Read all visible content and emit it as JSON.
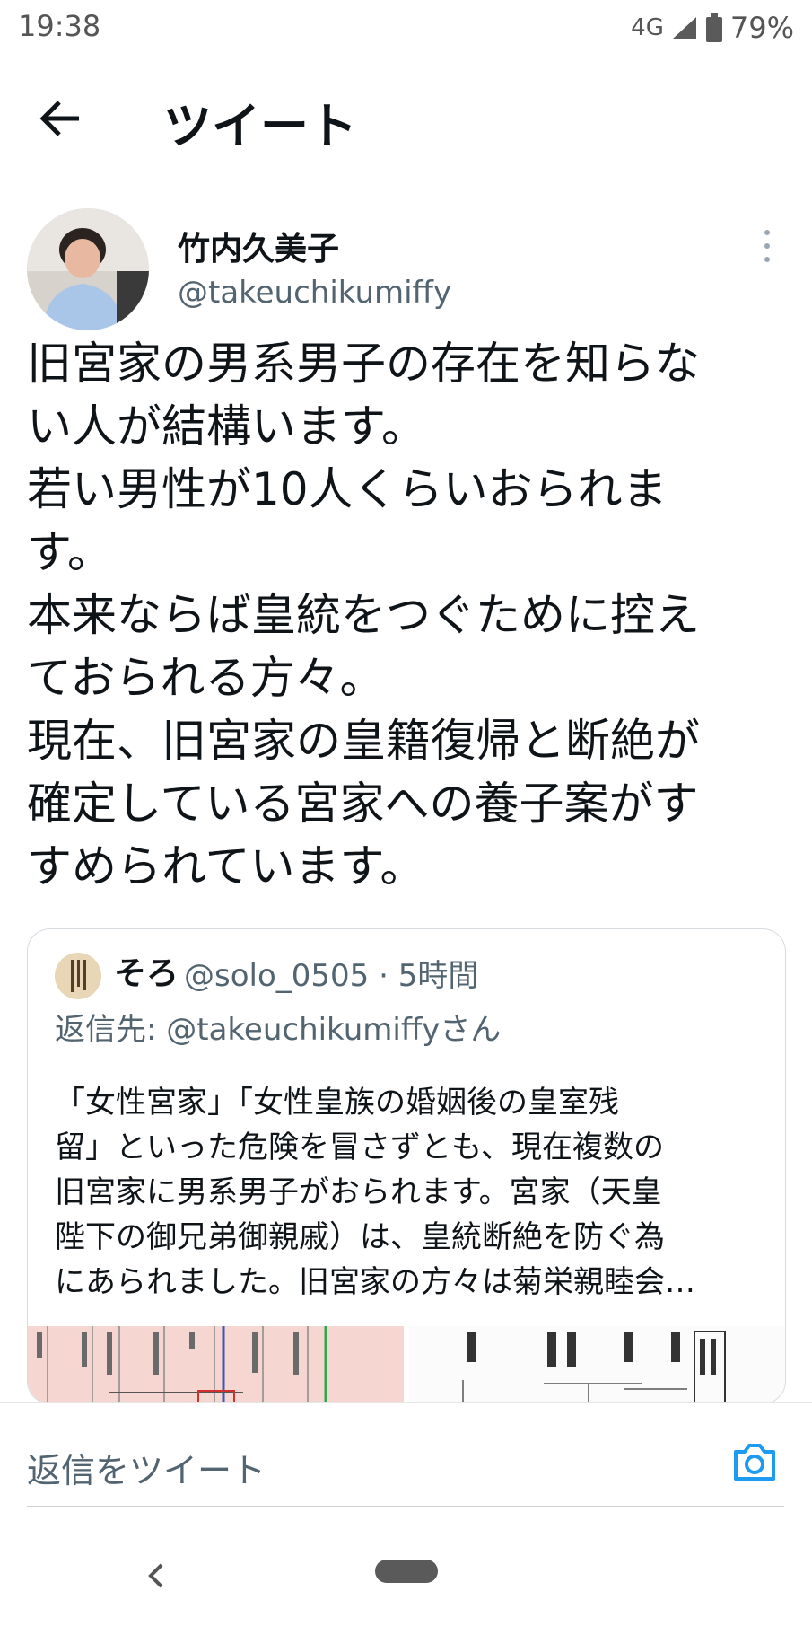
{
  "status_bar": {
    "time": "19:38",
    "network": "4G",
    "battery": "79%",
    "icons": [
      "signal-icon",
      "battery-icon"
    ]
  },
  "header": {
    "title": "ツイート",
    "back_icon": "arrow-left-icon"
  },
  "tweet": {
    "author_name": "竹内久美子",
    "author_handle": "@takeuchikumiffy",
    "more_icon": "more-vertical-icon",
    "text": "旧宮家の男系男子の存在を知らな\nい人が結構います。\n若い男性が10人くらいおられま\nす。\n本来ならば皇統をつぐために控え\nておられる方々。\n現在、旧宮家の皇籍復帰と断絶が\n確定している宮家への養子案がす\nすめられています。"
  },
  "quoted_tweet": {
    "author_name": "そろ",
    "author_handle": "@solo_0505 · 5時間",
    "reply_to": "返信先: @takeuchikumiffyさん",
    "text": "「女性宮家」「女性皇族の婚姻後の皇室残\n留」といった危険を冒さずとも、現在複数の\n旧宮家に男系男子がおられます。宮家（天皇\n陛下の御兄弟御親戚）は、皇統断絶を防ぐ為\nにあられました。旧宮家の方々は菊栄親睦会…"
  },
  "reply_bar": {
    "placeholder": "返信をツイート",
    "camera_icon": "camera-icon"
  },
  "nav_bar": {
    "icons": [
      "nav-back-icon",
      "nav-home-pill"
    ]
  },
  "colors": {
    "text": "#0f1419",
    "secondary": "#536471",
    "accent": "#1d9bf0",
    "border": "#d6dbe0"
  }
}
